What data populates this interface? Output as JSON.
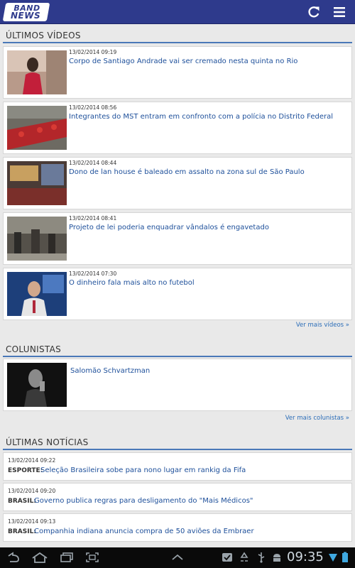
{
  "app": {
    "logo_line1": "BAND",
    "logo_line2": "NEWS",
    "refresh_icon": "refresh-icon",
    "menu_icon": "hamburger-menu-icon",
    "brand_color": "#2e3a8c",
    "accent_color": "#4a78b8",
    "link_color": "#1d4f9a"
  },
  "videos": {
    "section_title": "ÚLTIMOS VÍDEOS",
    "items": [
      {
        "date": "13/02/2014 09:19",
        "title": "Corpo de Santiago Andrade vai ser cremado nesta quinta no Rio"
      },
      {
        "date": "13/02/2014 08:56",
        "title": "Integrantes do MST entram em confronto com a polícia no Distrito Federal"
      },
      {
        "date": "13/02/2014 08:44",
        "title": "Dono de lan house é baleado em assalto na zona sul de São Paulo"
      },
      {
        "date": "13/02/2014 08:41",
        "title": "Projeto de lei poderia enquadrar vândalos é engavetado"
      },
      {
        "date": "13/02/2014 07:30",
        "title": "O dinheiro fala mais alto no futebol"
      }
    ],
    "more_label": "Ver mais vídeos »"
  },
  "columnists": {
    "section_title": "COLUNISTAS",
    "items": [
      {
        "name": "Salomão Schvartzman"
      }
    ],
    "more_label": "Ver mais colunistas »"
  },
  "news": {
    "section_title": "ÚLTIMAS NOTÍCIAS",
    "items": [
      {
        "date": "13/02/2014 09:22",
        "category": "ESPORTE:",
        "title": "Seleção Brasileira sobe para nono lugar em rankig da Fifa"
      },
      {
        "date": "13/02/2014 09:20",
        "category": "BRASIL:",
        "title": "Governo publica regras para desligamento do \"Mais Médicos\""
      },
      {
        "date": "13/02/2014 09:13",
        "category": "BRASIL:",
        "title": "Companhia indiana anuncia compra de 50 aviões da Embraer"
      }
    ]
  },
  "system_bar": {
    "time": "09:35",
    "icons": [
      "back-icon",
      "home-icon",
      "recent-apps-icon",
      "screenshot-icon",
      "up-chevron-icon",
      "check-notification-icon",
      "recycle-icon",
      "usb-icon",
      "android-debug-icon",
      "wifi-icon",
      "battery-icon"
    ]
  }
}
